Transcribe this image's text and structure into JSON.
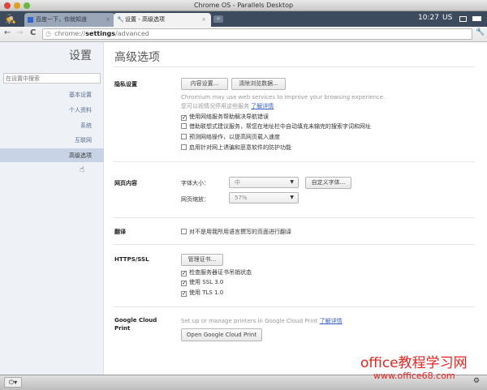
{
  "window": {
    "title": "Chrome OS - Parallels Desktop"
  },
  "tabs": [
    {
      "label": "百度一下，你就知道"
    },
    {
      "label": "设置 - 高级选项"
    }
  ],
  "status": {
    "time": "10:27",
    "input": "US"
  },
  "address": {
    "scheme": "chrome://",
    "host": "settings",
    "path": "/advanced"
  },
  "sidebar": {
    "title": "设置",
    "search_placeholder": "在设置中搜索",
    "items": [
      {
        "label": "基本设置"
      },
      {
        "label": "个人资料"
      },
      {
        "label": "系统"
      },
      {
        "label": "互联网"
      },
      {
        "label": "高级选项"
      }
    ]
  },
  "page_title": "高级选项",
  "privacy": {
    "heading": "隐私设置",
    "content_btn": "内容设置...",
    "clear_btn": "清除浏览数据...",
    "desc1": "Chromium may use web services to improve your browsing experience.",
    "desc2": "您可以视情况停用这些服务",
    "learn_more": "了解详情",
    "options": [
      {
        "label": "使用网络服务帮助解决导航错误",
        "checked": true
      },
      {
        "label": "借助联想式建议服务，帮您在地址栏中自动填充未输完的搜索字词和网址",
        "checked": false
      },
      {
        "label": "预测网络操作，以提高网页载入速度",
        "checked": false
      },
      {
        "label": "启用针对网上诱骗和恶意软件的防护功能",
        "checked": false
      }
    ]
  },
  "web_content": {
    "heading": "网页内容",
    "font_size_label": "字体大小：",
    "font_size_value": "中",
    "custom_fonts_btn": "自定义字体...",
    "zoom_label": "网页缩放：",
    "zoom_value": "57%"
  },
  "translate": {
    "heading": "翻译",
    "option": "对不是用我所用语言撰写的页面进行翻译",
    "checked": false
  },
  "ssl": {
    "heading": "HTTPS/SSL",
    "manage_btn": "管理证书...",
    "options": [
      {
        "label": "检查服务器证书吊销状态",
        "checked": true
      },
      {
        "label": "使用 SSL 3.0",
        "checked": true
      },
      {
        "label": "使用 TLS 1.0",
        "checked": true
      }
    ]
  },
  "cloud_print": {
    "heading1": "Google Cloud",
    "heading2": "Print",
    "desc": "Set up or manage printers in Google Cloud Print",
    "learn_more": "了解详情",
    "open_btn": "Open Google Cloud Print"
  },
  "watermark": {
    "line1": "office教程学习网",
    "line2": "www.office68.com"
  },
  "colors": {
    "tabstrip": "#3d4b5e",
    "sidebar": "#eef1f6",
    "selected": "#c8d3e6",
    "link": "#3a5fcd"
  }
}
